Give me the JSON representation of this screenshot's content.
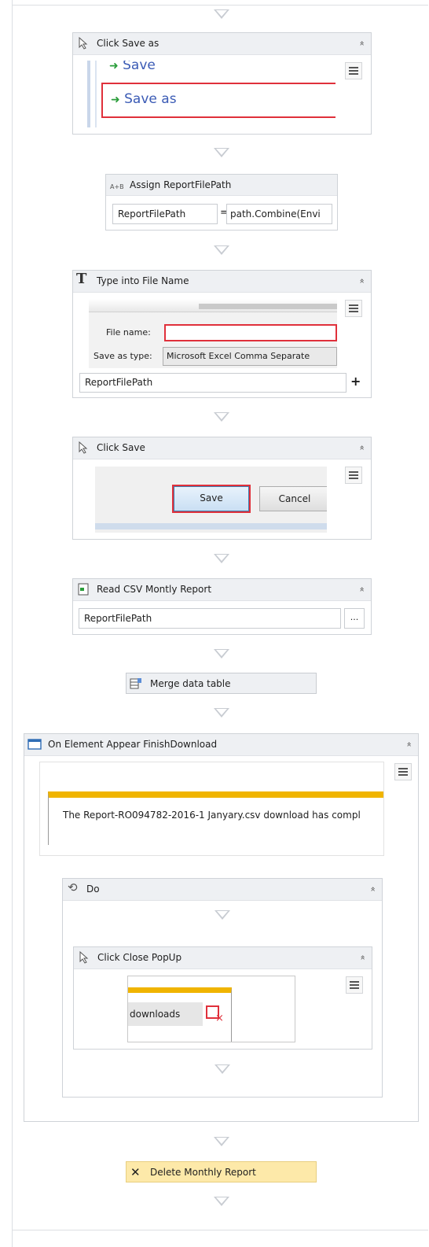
{
  "activities": {
    "click_save_as": {
      "title": "Click Save as",
      "screenshot": {
        "item_save": "Save",
        "item_save_as": "Save as"
      }
    },
    "assign": {
      "title": "Assign ReportFilePath",
      "to": "ReportFilePath",
      "equals": "=",
      "value": "path.Combine(Envi"
    },
    "type_into": {
      "title": "Type into File Name",
      "screenshot": {
        "file_name_label": "File name:",
        "save_as_type_label": "Save as type:",
        "save_as_type_value": "Microsoft Excel Comma Separate"
      },
      "text_value": "ReportFilePath",
      "plus": "+"
    },
    "click_save": {
      "title": "Click Save",
      "screenshot": {
        "save_button": "Save",
        "cancel_button": "Cancel"
      }
    },
    "read_csv": {
      "title": "Read CSV Montly Report",
      "path_value": "ReportFilePath",
      "browse": "..."
    },
    "merge": {
      "title": "Merge data table"
    },
    "on_element_appear": {
      "title": "On Element Appear FinishDownload",
      "screenshot": {
        "message": "The Report-RO094782-2016-1 Janyary.csv download has compl"
      },
      "do": {
        "title": "Do",
        "click_close": {
          "title": "Click Close PopUp",
          "screenshot": {
            "label": "downloads",
            "close_mark": "×"
          }
        }
      }
    },
    "delete": {
      "title": "Delete Monthly Report"
    }
  },
  "icons": {
    "collapse": "«",
    "accent_green": "#2a9d3a",
    "highlight_red": "#e0303b",
    "bar_yellow": "#f0b400",
    "activity_yellow": "#fde9a9"
  }
}
